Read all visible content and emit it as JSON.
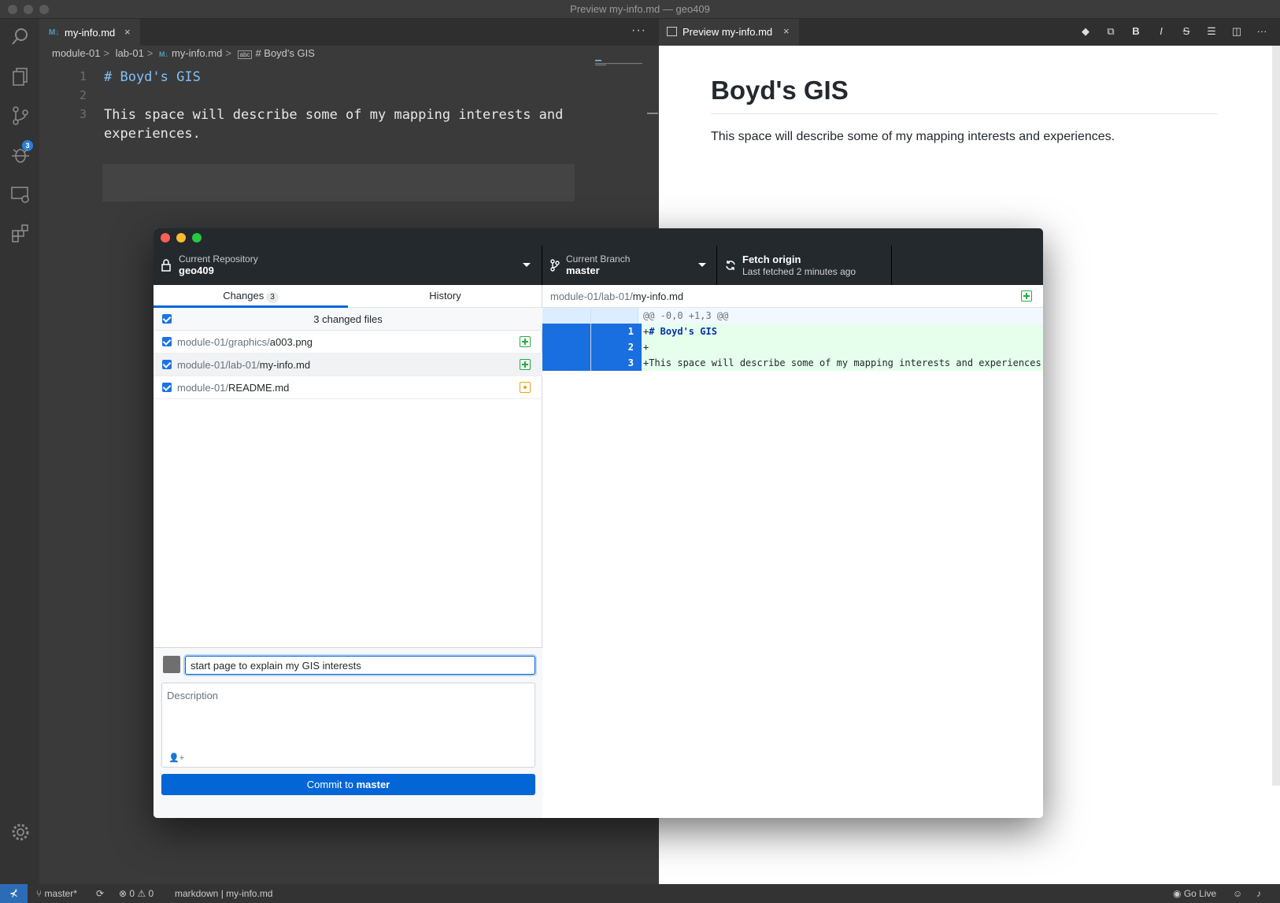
{
  "window_title": "Preview my-info.md — geo409",
  "editor": {
    "tab_label": "my-info.md",
    "tab_close": "×",
    "more": "···",
    "breadcrumb": [
      "module-01",
      "lab-01",
      "my-info.md",
      "# Boyd's GIS"
    ],
    "breadcrumb_sep": ">",
    "line_numbers": [
      "1",
      "2",
      "3"
    ],
    "lines": [
      "# Boyd's GIS",
      "",
      "This space will describe some of my mapping interests and",
      "experiences."
    ]
  },
  "activity_bar": {
    "items": [
      "search-icon",
      "files-icon",
      "source-control-icon",
      "debug-icon",
      "remote-explorer-icon",
      "extensions-icon"
    ],
    "scm_badge": "3",
    "bottom": "gear-icon"
  },
  "preview": {
    "tab_label": "Preview my-info.md",
    "tab_close": "×",
    "toolbar": [
      "git-icon",
      "open-file-icon",
      "B",
      "I",
      "S",
      "list-icon",
      "split-icon",
      "···"
    ],
    "heading": "Boyd's GIS",
    "paragraph": "This space will describe some of my mapping interests and experiences."
  },
  "statusbar": {
    "remote": "⊀",
    "branch": "master*",
    "sync": "⟳",
    "problems": "⊗ 0 ⚠ 0",
    "language": "markdown | ",
    "file": "my-info.md",
    "go_live": "Go Live"
  },
  "github": {
    "repo_label": "Current Repository",
    "repo_name": "geo409",
    "branch_label": "Current Branch",
    "branch_name": "master",
    "fetch_title": "Fetch origin",
    "fetch_sub": "Last fetched 2 minutes ago",
    "tab_changes": "Changes",
    "tab_changes_count": "3",
    "tab_history": "History",
    "changed_summary": "3 changed files",
    "files": [
      {
        "dir": "module-01/graphics/",
        "name": "a003.png",
        "status": "added"
      },
      {
        "dir": "module-01/lab-01/",
        "name": "my-info.md",
        "status": "added"
      },
      {
        "dir": "module-01/",
        "name": "README.md",
        "status": "modified"
      }
    ],
    "summary_value": "start page to explain my GIS interests",
    "description_placeholder": "Description",
    "coauthor": "👤+",
    "commit_prefix": "Commit to ",
    "commit_branch": "master",
    "diff_dir": "module-01/lab-01/",
    "diff_file": "my-info.md",
    "hunk": "@@ -0,0 +1,3 @@",
    "diff_lines": [
      {
        "n": "1",
        "prefix": "+",
        "text": "# Boyd's GIS"
      },
      {
        "n": "2",
        "prefix": "+",
        "text": ""
      },
      {
        "n": "3",
        "prefix": "+",
        "text": "This space will describe some of my mapping interests and experiences."
      }
    ],
    "no_newline_marker": "⊘↵"
  }
}
